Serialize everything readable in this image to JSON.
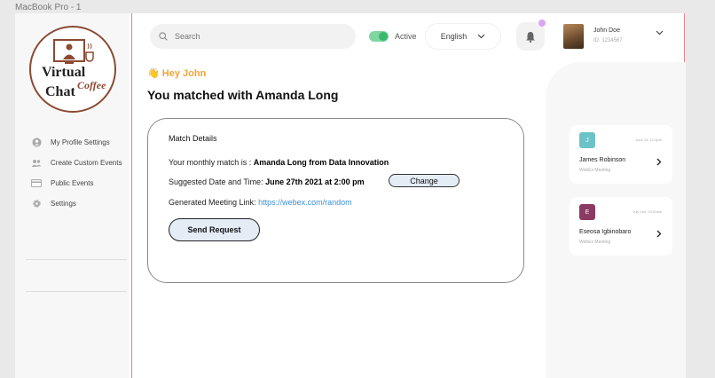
{
  "frame_label": "MacBook Pro - 1",
  "logo": {
    "line1": "Virtual",
    "line2": "Coffee",
    "line3": "Chat"
  },
  "sidebar": {
    "items": [
      {
        "label": "My Profile Settings",
        "icon": "user-circle-icon"
      },
      {
        "label": "Create Custom Events",
        "icon": "users-icon"
      },
      {
        "label": "Public Events",
        "icon": "card-icon"
      },
      {
        "label": "Settings",
        "icon": "gear-icon"
      }
    ]
  },
  "header": {
    "search_placeholder": "Search",
    "status_label": "Active",
    "language": "English",
    "user": {
      "name": "John Doe",
      "id": "ID: 1234567"
    }
  },
  "greeting": "Hey John",
  "title": "You matched with Amanda Long",
  "match": {
    "heading": "Match Details",
    "monthly_label": "Your monthly match is  : ",
    "monthly_value": "Amanda Long from Data Innovation",
    "date_label": "Suggested Date and Time: ",
    "date_value": "June 27th 2021 at 2:00 pm",
    "change_label": "Change",
    "link_label": "Generated Meeting Link: ",
    "link_value": "https://webex.com/random",
    "send_label": "Send Request"
  },
  "meetings": [
    {
      "initial": "J",
      "date": "June 24, 12:0pm",
      "name": "James Robinson",
      "sub": "WebEx Meeting",
      "color": "#6cc3c7"
    },
    {
      "initial": "E",
      "date": "July 2nd, 04:00am",
      "name": "Eseosa Igbinobaro",
      "sub": "WebEx Meeting",
      "color": "#8b3a62"
    }
  ],
  "colors": {
    "accent": "#f0a43a",
    "toggle": "#3bb86e",
    "button": "#e4ecf6",
    "link": "#3b8fd6"
  }
}
